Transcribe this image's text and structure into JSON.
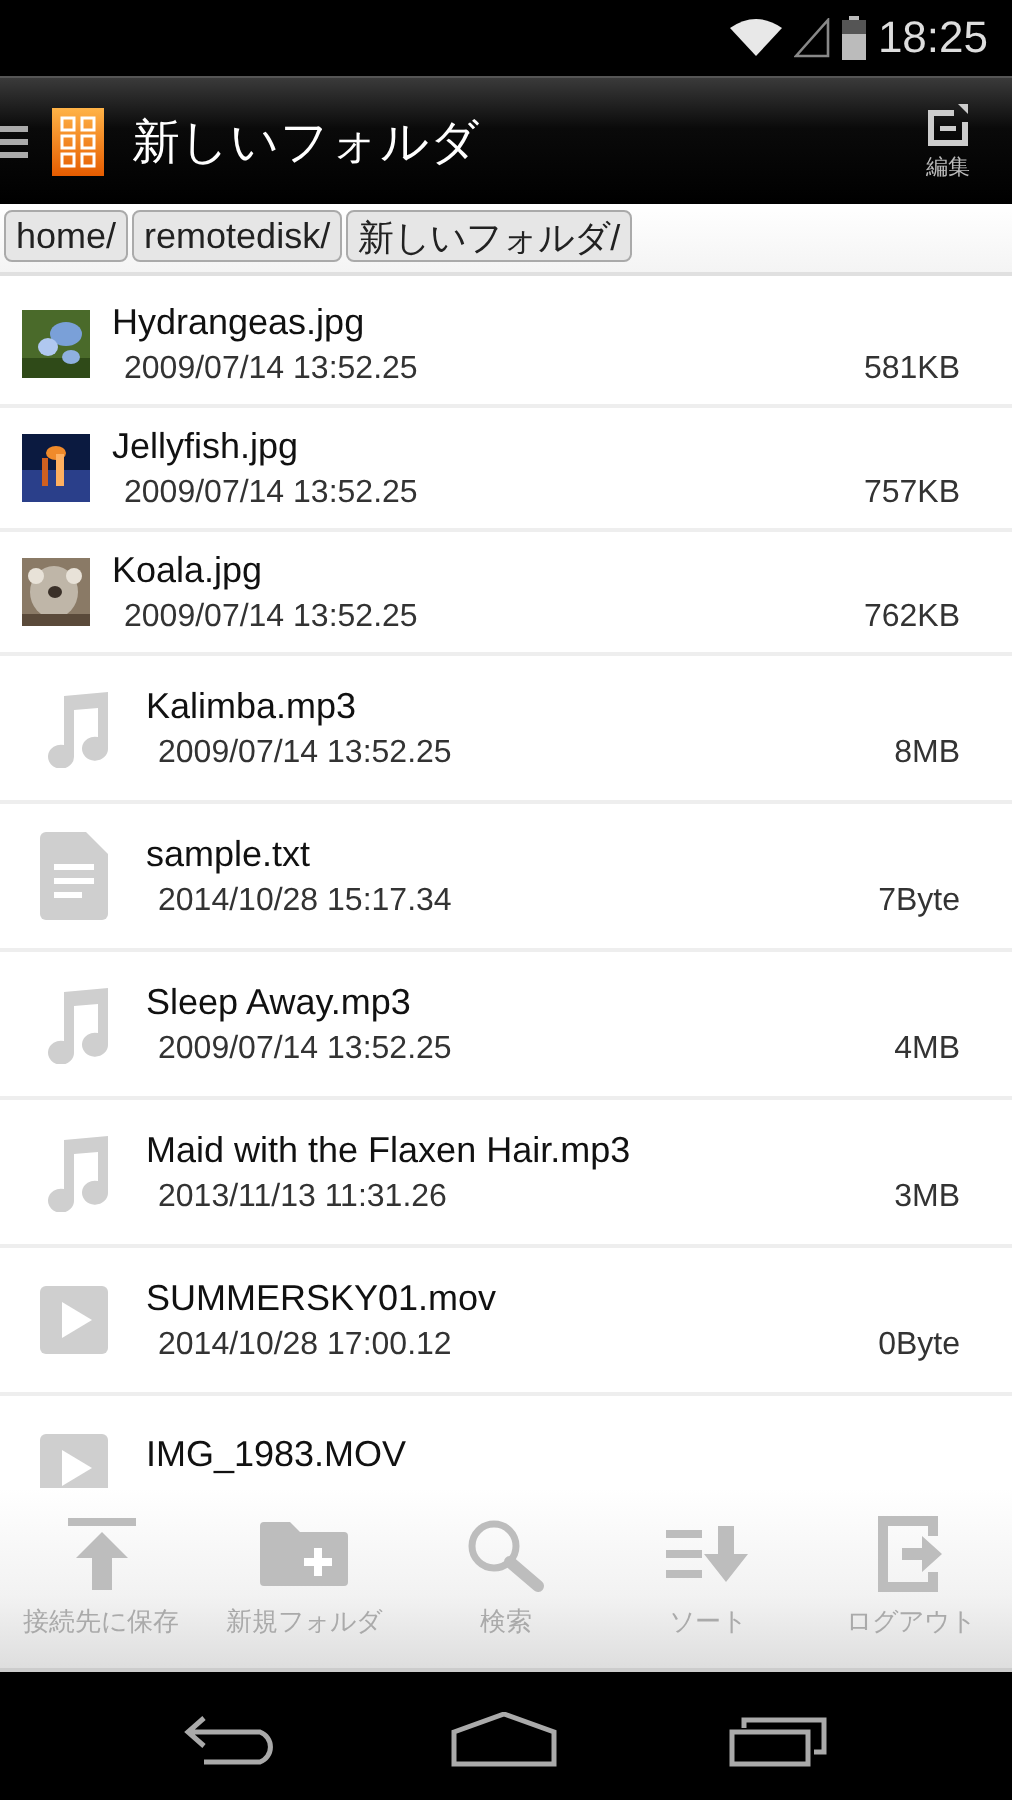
{
  "status_bar": {
    "time": "18:25"
  },
  "app_bar": {
    "title": "新しいフォルダ",
    "edit_label": "編集"
  },
  "breadcrumbs": [
    "home/",
    "remotedisk/",
    "新しいフォルダ/"
  ],
  "files": [
    {
      "name": "Hydrangeas.jpg",
      "date": "2009/07/14 13:52.25",
      "size": "581KB"
    },
    {
      "name": "Jellyfish.jpg",
      "date": "2009/07/14 13:52.25",
      "size": "757KB"
    },
    {
      "name": "Koala.jpg",
      "date": "2009/07/14 13:52.25",
      "size": "762KB"
    },
    {
      "kind": "audio",
      "name": "Kalimba.mp3",
      "date": "2009/07/14 13:52.25",
      "size": "8MB"
    },
    {
      "kind": "text",
      "name": "sample.txt",
      "date": "2014/10/28 15:17.34",
      "size": "7Byte"
    },
    {
      "kind": "audio",
      "name": "Sleep Away.mp3",
      "date": "2009/07/14 13:52.25",
      "size": "4MB"
    },
    {
      "kind": "audio",
      "name": "Maid with the Flaxen Hair.mp3",
      "date": "2013/11/13 11:31.26",
      "size": "3MB"
    },
    {
      "kind": "video",
      "name": "SUMMERSKY01.mov",
      "date": "2014/10/28 17:00.12",
      "size": "0Byte"
    },
    {
      "kind": "video",
      "name": "IMG_1983.MOV"
    }
  ],
  "toolbar": [
    {
      "kind": "upload",
      "label": "接続先に保存"
    },
    {
      "kind": "new-folder",
      "label": "新規フォルダ"
    },
    {
      "kind": "search",
      "label": "検索"
    },
    {
      "kind": "sort",
      "label": "ソート"
    },
    {
      "kind": "logout",
      "label": "ログアウト"
    }
  ]
}
